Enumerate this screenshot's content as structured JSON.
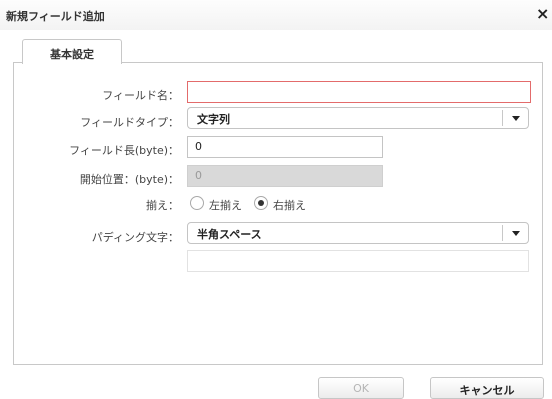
{
  "dialog": {
    "title": "新規フィールド追加",
    "close_glyph": "×"
  },
  "tabs": [
    {
      "label": "基本設定",
      "active": true
    }
  ],
  "form": {
    "field_name": {
      "label": "フィールド名：",
      "value": "",
      "state": "error"
    },
    "field_type": {
      "label": "フィールドタイプ：",
      "value": "文字列"
    },
    "field_length": {
      "label": "フィールド長(byte)：",
      "value": "0"
    },
    "start_position": {
      "label": "開始位置：(byte)：",
      "value": "0",
      "disabled": true
    },
    "alignment": {
      "label": "揃え：",
      "options": [
        {
          "label": "左揃え",
          "checked": false
        },
        {
          "label": "右揃え",
          "checked": true
        }
      ]
    },
    "padding_char": {
      "label": "パディング文字：",
      "value": "半角スペース"
    },
    "padding_extra": {
      "value": ""
    }
  },
  "footer": {
    "ok_label": "OK",
    "cancel_label": "キャンセル"
  },
  "colors": {
    "error_border": "#e36b6b",
    "disabled_bg": "#d9d9d9"
  }
}
